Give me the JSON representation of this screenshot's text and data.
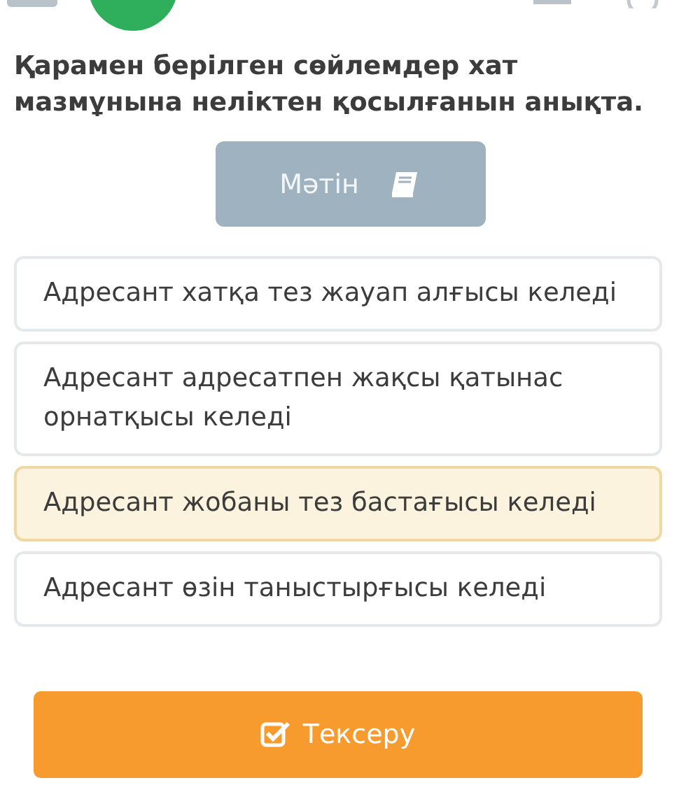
{
  "question": "Қарамен берілген сөйлемдер хат мазмұнына неліктен қосылғанын анықта.",
  "text_button": {
    "label": "Мәтін"
  },
  "options": [
    {
      "label": "Адресант хатқа тез жауап алғысы келеді",
      "selected": false
    },
    {
      "label": "Адресант адресатпен жақсы қатынас орнатқысы келеді",
      "selected": false
    },
    {
      "label": "Адресант жобаны тез бастағысы келеді",
      "selected": true
    },
    {
      "label": "Адресант өзін таныстырғысы келеді",
      "selected": false
    }
  ],
  "check_button": {
    "label": "Тексеру"
  }
}
